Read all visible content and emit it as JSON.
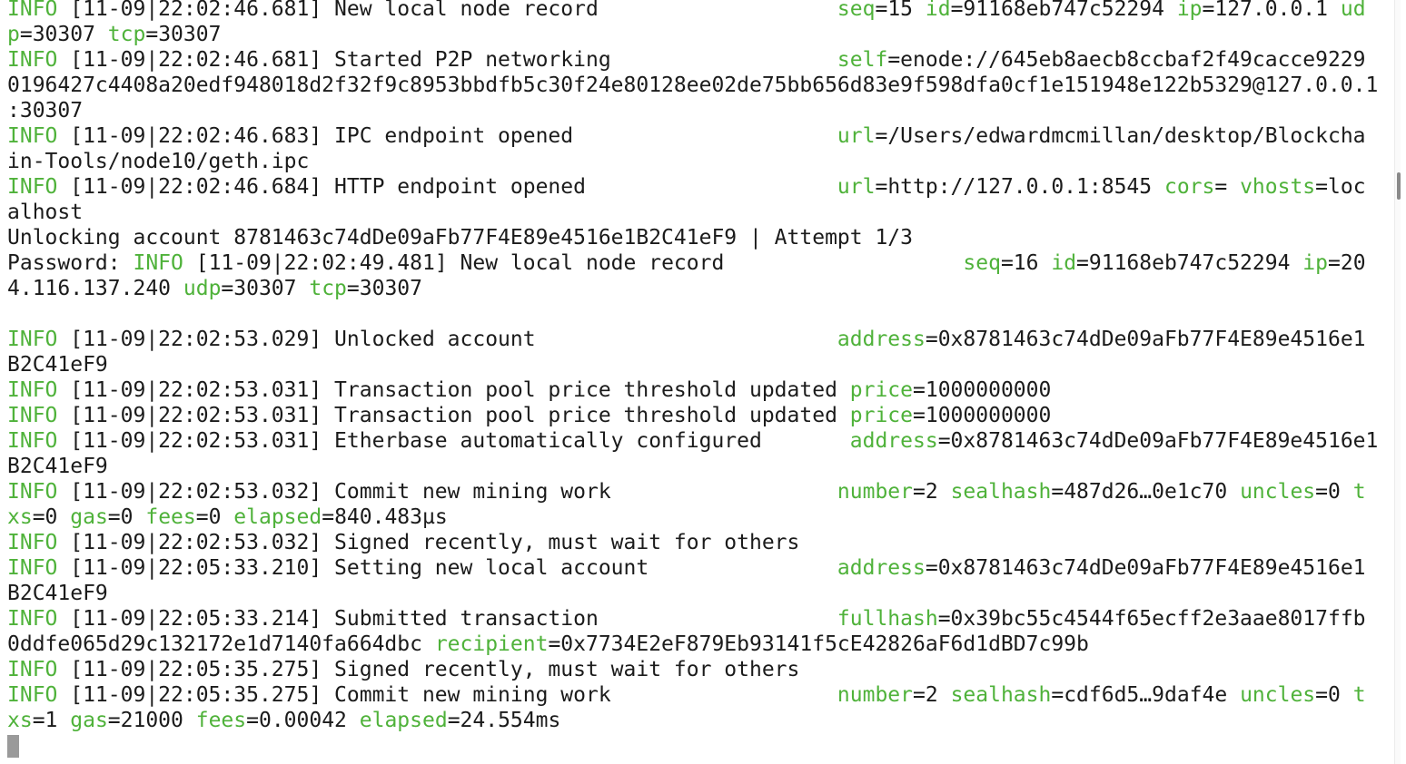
{
  "terminal": {
    "lines": [
      [
        {
          "t": "INFO",
          "c": "lvl"
        },
        {
          "t": " [11-09|22:02:46.681] New local node record                   "
        },
        {
          "t": "seq",
          "c": "key"
        },
        {
          "t": "=15 "
        },
        {
          "t": "id",
          "c": "key"
        },
        {
          "t": "=91168eb747c52294 "
        },
        {
          "t": "ip",
          "c": "key"
        },
        {
          "t": "=127.0.0.1 "
        },
        {
          "t": "ud",
          "c": "key"
        }
      ],
      [
        {
          "t": "p",
          "c": "key"
        },
        {
          "t": "=30307 "
        },
        {
          "t": "tcp",
          "c": "key"
        },
        {
          "t": "=30307"
        }
      ],
      [
        {
          "t": "INFO",
          "c": "lvl"
        },
        {
          "t": " [11-09|22:02:46.681] Started P2P networking                  "
        },
        {
          "t": "self",
          "c": "key"
        },
        {
          "t": "=enode://645eb8aecb8ccbaf2f49cacce9229"
        }
      ],
      [
        {
          "t": "0196427c4408a20edf948018d2f32f9c8953bbdfb5c30f24e80128ee02de75bb656d83e9f598dfa0cf1e151948e122b5329@127.0.0.1"
        }
      ],
      [
        {
          "t": ":30307"
        }
      ],
      [
        {
          "t": "INFO",
          "c": "lvl"
        },
        {
          "t": " [11-09|22:02:46.683] IPC endpoint opened                     "
        },
        {
          "t": "url",
          "c": "key"
        },
        {
          "t": "=/Users/edwardmcmillan/desktop/Blockcha"
        }
      ],
      [
        {
          "t": "in-Tools/node10/geth.ipc"
        }
      ],
      [
        {
          "t": "INFO",
          "c": "lvl"
        },
        {
          "t": " [11-09|22:02:46.684] HTTP endpoint opened                    "
        },
        {
          "t": "url",
          "c": "key"
        },
        {
          "t": "=http://127.0.0.1:8545 "
        },
        {
          "t": "cors",
          "c": "key"
        },
        {
          "t": "= "
        },
        {
          "t": "vhosts",
          "c": "key"
        },
        {
          "t": "=loc"
        }
      ],
      [
        {
          "t": "alhost"
        }
      ],
      [
        {
          "t": "Unlocking account 8781463c74dDe09aFb77F4E89e4516e1B2C41eF9 | Attempt 1/3"
        }
      ],
      [
        {
          "t": "Password: "
        },
        {
          "t": "INFO",
          "c": "lvl"
        },
        {
          "t": " [11-09|22:02:49.481] New local node record                   "
        },
        {
          "t": "seq",
          "c": "key"
        },
        {
          "t": "=16 "
        },
        {
          "t": "id",
          "c": "key"
        },
        {
          "t": "=91168eb747c52294 "
        },
        {
          "t": "ip",
          "c": "key"
        },
        {
          "t": "=20"
        }
      ],
      [
        {
          "t": "4.116.137.240 "
        },
        {
          "t": "udp",
          "c": "key"
        },
        {
          "t": "=30307 "
        },
        {
          "t": "tcp",
          "c": "key"
        },
        {
          "t": "=30307"
        }
      ],
      [],
      [
        {
          "t": "INFO",
          "c": "lvl"
        },
        {
          "t": " [11-09|22:02:53.029] Unlocked account                        "
        },
        {
          "t": "address",
          "c": "key"
        },
        {
          "t": "=0x8781463c74dDe09aFb77F4E89e4516e1"
        }
      ],
      [
        {
          "t": "B2C41eF9"
        }
      ],
      [
        {
          "t": "INFO",
          "c": "lvl"
        },
        {
          "t": " [11-09|22:02:53.031] Transaction pool price threshold updated "
        },
        {
          "t": "price",
          "c": "key"
        },
        {
          "t": "=1000000000"
        }
      ],
      [
        {
          "t": "INFO",
          "c": "lvl"
        },
        {
          "t": " [11-09|22:02:53.031] Transaction pool price threshold updated "
        },
        {
          "t": "price",
          "c": "key"
        },
        {
          "t": "=1000000000"
        }
      ],
      [
        {
          "t": "INFO",
          "c": "lvl"
        },
        {
          "t": " [11-09|22:02:53.031] Etherbase automatically configured       "
        },
        {
          "t": "address",
          "c": "key"
        },
        {
          "t": "=0x8781463c74dDe09aFb77F4E89e4516e1"
        }
      ],
      [
        {
          "t": "B2C41eF9"
        }
      ],
      [
        {
          "t": "INFO",
          "c": "lvl"
        },
        {
          "t": " [11-09|22:02:53.032] Commit new mining work                  "
        },
        {
          "t": "number",
          "c": "key"
        },
        {
          "t": "=2 "
        },
        {
          "t": "sealhash",
          "c": "key"
        },
        {
          "t": "=487d26…0e1c70 "
        },
        {
          "t": "uncles",
          "c": "key"
        },
        {
          "t": "=0 "
        },
        {
          "t": "t",
          "c": "key"
        }
      ],
      [
        {
          "t": "xs",
          "c": "key"
        },
        {
          "t": "=0 "
        },
        {
          "t": "gas",
          "c": "key"
        },
        {
          "t": "=0 "
        },
        {
          "t": "fees",
          "c": "key"
        },
        {
          "t": "=0 "
        },
        {
          "t": "elapsed",
          "c": "key"
        },
        {
          "t": "=840.483µs"
        }
      ],
      [
        {
          "t": "INFO",
          "c": "lvl"
        },
        {
          "t": " [11-09|22:02:53.032] Signed recently, must wait for others"
        }
      ],
      [
        {
          "t": "INFO",
          "c": "lvl"
        },
        {
          "t": " [11-09|22:05:33.210] Setting new local account               "
        },
        {
          "t": "address",
          "c": "key"
        },
        {
          "t": "=0x8781463c74dDe09aFb77F4E89e4516e1"
        }
      ],
      [
        {
          "t": "B2C41eF9"
        }
      ],
      [
        {
          "t": "INFO",
          "c": "lvl"
        },
        {
          "t": " [11-09|22:05:33.214] Submitted transaction                   "
        },
        {
          "t": "fullhash",
          "c": "key"
        },
        {
          "t": "=0x39bc55c4544f65ecff2e3aae8017ffb"
        }
      ],
      [
        {
          "t": "0ddfe065d29c132172e1d7140fa664dbc "
        },
        {
          "t": "recipient",
          "c": "key"
        },
        {
          "t": "=0x7734E2eF879Eb93141f5cE42826aF6d1dBD7c99b"
        }
      ],
      [
        {
          "t": "INFO",
          "c": "lvl"
        },
        {
          "t": " [11-09|22:05:35.275] Signed recently, must wait for others"
        }
      ],
      [
        {
          "t": "INFO",
          "c": "lvl"
        },
        {
          "t": " [11-09|22:05:35.275] Commit new mining work                  "
        },
        {
          "t": "number",
          "c": "key"
        },
        {
          "t": "=2 "
        },
        {
          "t": "sealhash",
          "c": "key"
        },
        {
          "t": "=cdf6d5…9daf4e "
        },
        {
          "t": "uncles",
          "c": "key"
        },
        {
          "t": "=0 "
        },
        {
          "t": "t",
          "c": "key"
        }
      ],
      [
        {
          "t": "xs",
          "c": "key"
        },
        {
          "t": "=1 "
        },
        {
          "t": "gas",
          "c": "key"
        },
        {
          "t": "=21000 "
        },
        {
          "t": "fees",
          "c": "key"
        },
        {
          "t": "=0.00042 "
        },
        {
          "t": "elapsed",
          "c": "key"
        },
        {
          "t": "=24.554ms"
        }
      ]
    ],
    "colors": {
      "background": "#ffffff",
      "text": "#1b1b1b",
      "level_and_keys": "#4fb23a",
      "cursor": "#9a9a9a"
    }
  }
}
